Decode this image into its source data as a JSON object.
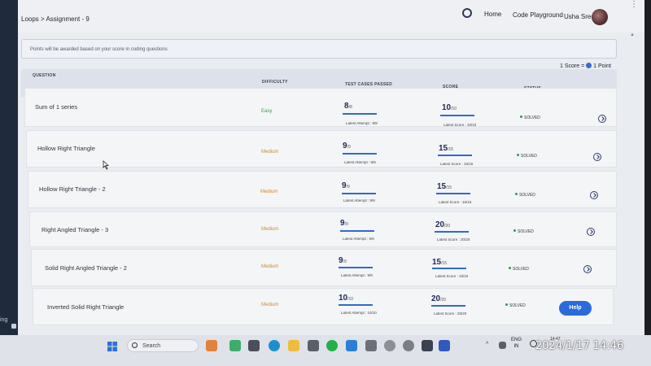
{
  "header": {
    "breadcrumb": "Loops > Assignment - 9",
    "nav_home": "Home",
    "nav_code_playground": "Code Playground",
    "user_name": "Usha Sree"
  },
  "notice": "Points will be awarded based on your score in coding questions",
  "score_info": {
    "left": "1 Score =",
    "right": "1 Point"
  },
  "table": {
    "headers": {
      "question": "QUESTION",
      "difficulty": "DIFFICULTY",
      "test_cases": "TEST CASES PASSED",
      "score": "SCORE",
      "status": "STATUS"
    },
    "rows": [
      {
        "question": "Sum of 1 series",
        "difficulty": "Easy",
        "tc_passed": "8",
        "tc_total": "/8",
        "tc_latest": "Latest Attempt : 8/8",
        "score": "10",
        "score_total": "/10",
        "score_latest": "Latest Score : 10/10",
        "status": "SOLVED"
      },
      {
        "question": "Hollow Right Triangle",
        "difficulty": "Medium",
        "tc_passed": "9",
        "tc_total": "/9",
        "tc_latest": "Latest Attempt : 9/9",
        "score": "15",
        "score_total": "/15",
        "score_latest": "Latest Score : 15/15",
        "status": "SOLVED"
      },
      {
        "question": "Hollow Right Triangle - 2",
        "difficulty": "Medium",
        "tc_passed": "9",
        "tc_total": "/9",
        "tc_latest": "Latest Attempt : 9/9",
        "score": "15",
        "score_total": "/15",
        "score_latest": "Latest Score : 15/15",
        "status": "SOLVED"
      },
      {
        "question": "Right Angled Triangle - 3",
        "difficulty": "Medium",
        "tc_passed": "9",
        "tc_total": "/9",
        "tc_latest": "Latest Attempt : 9/9",
        "score": "20",
        "score_total": "/20",
        "score_latest": "Latest Score : 20/20",
        "status": "SOLVED"
      },
      {
        "question": "Solid Right Angled Triangle - 2",
        "difficulty": "Medium",
        "tc_passed": "9",
        "tc_total": "/9",
        "tc_latest": "Latest Attempt : 9/9",
        "score": "15",
        "score_total": "/15",
        "score_latest": "Latest Score : 15/15",
        "status": "SOLVED"
      },
      {
        "question": "Inverted Solid Right Triangle",
        "difficulty": "Medium",
        "tc_passed": "10",
        "tc_total": "/10",
        "tc_latest": "Latest Attempt : 10/10",
        "score": "20",
        "score_total": "/20",
        "score_latest": "Latest Score : 20/20",
        "status": "SOLVED"
      }
    ]
  },
  "help_label": "Help",
  "taskbar": {
    "search_placeholder": "Search",
    "lang_line1": "ENG",
    "lang_line2": "IN",
    "time": "14:47"
  },
  "bezel_text": "ing",
  "photo_timestamp": "2024/1/17 14:46",
  "colors": {
    "accent": "#2b6ad9",
    "easy": "#3d9a46",
    "medium": "#d28a2c",
    "solved_dot": "#2c9b4a"
  }
}
